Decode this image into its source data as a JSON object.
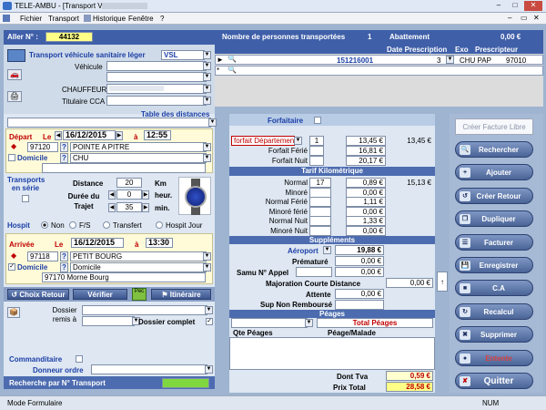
{
  "window": {
    "title": "TELE-AMBU - [Transport VSL"
  },
  "menu": [
    "Fichier",
    "Transport",
    "Historique",
    "Fenêtre",
    "?"
  ],
  "top": {
    "aller_label": "Aller N° :",
    "aller_value": "44132",
    "persons_label": "Nombre de personnes transportées",
    "persons_value": "1",
    "abattement_label": "Abattement",
    "abattement_value": "0,00 €"
  },
  "prescription": {
    "col_date": "Date Prescription",
    "col_exo": "Exo",
    "col_prescripteur": "Prescripteur",
    "row_value": "151216001",
    "exo": "3",
    "prescripteur": "CHU PAP",
    "prescripteur_code": "97010"
  },
  "vehicle": {
    "section": "Transport véhicule sanitaire léger",
    "type": "VSL",
    "vehicule_label": "Véhicule",
    "chauffeur_label": "CHAUFFEUR",
    "titulaire_label": "Titulaire CCA"
  },
  "distances": {
    "label": "Table des distances"
  },
  "depart": {
    "label": "Départ",
    "le": "Le",
    "date": "16/12/2015",
    "a": "à",
    "time": "12:55",
    "code": "97120",
    "place": "POINTE A PITRE",
    "domicile_label": "Domicile",
    "establishment": "CHU"
  },
  "trajet": {
    "serie_label": "Transports en série",
    "distance_label": "Distance",
    "distance_value": "20",
    "km": "Km",
    "duree_label": "Durée du Trajet",
    "hours": "0",
    "heur": "heur.",
    "minutes": "35",
    "min": "min."
  },
  "hospit": {
    "label": "Hospit",
    "non": "Non",
    "fs": "F/S",
    "transfert": "Transfert",
    "jour": "Hospit Jour"
  },
  "arrivee": {
    "label": "Arrivée",
    "le": "Le",
    "date": "16/12/2015",
    "a": "à",
    "time": "13:30",
    "code": "97118",
    "place": "PETIT BOURG",
    "domicile_label": "Domicile",
    "domicile_value": "Domicile",
    "address": "97170 Morne Bourg"
  },
  "actions": {
    "choix_retour": "Choix Retour",
    "verifier": "Vérifier",
    "pec": "Pec",
    "itineraire": "Itinéraire"
  },
  "dossier": {
    "remis_label": "Dossier remis à",
    "complet_label": "Dossier complet"
  },
  "bottom": {
    "commanditaire": "Commanditaire",
    "donneur": "Donneur ordre",
    "recherche": "Recherche par N° Transport"
  },
  "tarif": {
    "forfaitaire": "Forfaitaire",
    "forfait_select": "forfait Département",
    "forfait_rows": [
      {
        "label": "",
        "qty": "1",
        "price": "13,45 €",
        "total": "13,45 €"
      },
      {
        "label": "Forfait Férié",
        "qty": "",
        "price": "16,81 €",
        "total": ""
      },
      {
        "label": "Forfait Nuit",
        "qty": "",
        "price": "20,17 €",
        "total": ""
      }
    ],
    "km_header": "Tarif Kilométrique",
    "km_rows": [
      {
        "label": "Normal",
        "qty": "17",
        "price": "0,89 €",
        "total": "15,13 €"
      },
      {
        "label": "Minoré",
        "qty": "",
        "price": "0,00 €",
        "total": ""
      },
      {
        "label": "Normal Férié",
        "qty": "",
        "price": "1,11 €",
        "total": ""
      },
      {
        "label": "Minoré férié",
        "qty": "",
        "price": "0,00 €",
        "total": ""
      },
      {
        "label": "Normal Nuit",
        "qty": "",
        "price": "1,33 €",
        "total": ""
      },
      {
        "label": "Minoré Nuit",
        "qty": "",
        "price": "0,00 €",
        "total": ""
      }
    ],
    "supp_header": "Suppléments",
    "aeroport": "Aéroport",
    "aeroport_value": "19,88 €",
    "premature": "Prématuré",
    "premature_value": "0,00 €",
    "samu": "Samu  N° Appel",
    "samu_value": "0,00 €",
    "majoration": "Majoration Courte Distance",
    "majoration_value": "0,00 €",
    "attente": "Attente",
    "attente_value": "0,00 €",
    "sup_non": "Sup Non Remboursé",
    "peages_header": "Péages",
    "total_peages": "Total Péages",
    "qte_peages": "Qte Péages",
    "peage_malade": "Péage/Malade",
    "dont_tva": "Dont Tva",
    "dont_tva_value": "0,59 €",
    "prix_total": "Prix Total",
    "prix_total_value": "28,58 €"
  },
  "side": {
    "creer_facture": "Créer Facture Libre",
    "buttons": [
      "Rechercher",
      "Ajouter",
      "Créer Retour",
      "Dupliquer",
      "Facturer",
      "Enregistrer",
      "C.A",
      "Recalcul",
      "Supprimer",
      "Entente",
      "Quitter"
    ]
  },
  "status": {
    "mode": "Mode Formulaire",
    "num": "NUM"
  }
}
